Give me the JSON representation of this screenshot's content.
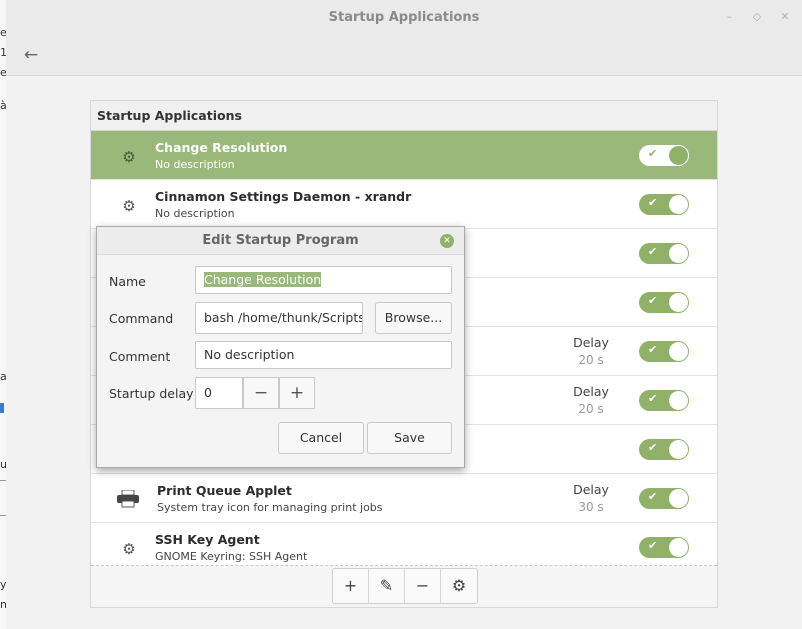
{
  "window": {
    "title": "Startup Applications",
    "back_icon": "back-arrow-icon",
    "controls": {
      "minimize": "–",
      "restore": "◇",
      "close": "✕"
    }
  },
  "panel": {
    "heading": "Startup Applications",
    "delay_label": "Delay"
  },
  "apps": [
    {
      "name": "Change Resolution",
      "description": "No description",
      "enabled": true,
      "delay": "",
      "icon": "gear-icon"
    },
    {
      "name": "Cinnamon Settings Daemon - xrandr",
      "description": "No description",
      "enabled": true,
      "delay": "",
      "icon": "gear-icon"
    },
    {
      "name": "",
      "description": "",
      "enabled": true,
      "delay": "",
      "icon": ""
    },
    {
      "name": "",
      "description": "",
      "enabled": true,
      "delay": "",
      "icon": ""
    },
    {
      "name": "",
      "description": "",
      "enabled": true,
      "delay": "20 s",
      "icon": ""
    },
    {
      "name": "",
      "description": "",
      "enabled": true,
      "delay": "20 s",
      "icon": ""
    },
    {
      "name": "",
      "description": "",
      "enabled": true,
      "delay": "",
      "icon": ""
    },
    {
      "name": "Print Queue Applet",
      "description": "System tray icon for managing print jobs",
      "enabled": true,
      "delay": "30 s",
      "icon": "printer-icon"
    },
    {
      "name": "SSH Key Agent",
      "description": "GNOME Keyring: SSH Agent",
      "enabled": true,
      "delay": "",
      "icon": "gear-icon"
    }
  ],
  "toolbar": {
    "add": "+",
    "edit": "✎",
    "remove": "−",
    "settings": "⚙"
  },
  "dialog": {
    "title": "Edit Startup Program",
    "name_label": "Name",
    "name_value": "Change Resolution",
    "command_label": "Command",
    "command_value": "bash  /home/thunk/Scripts/",
    "browse_label": "Browse...",
    "comment_label": "Comment",
    "comment_value": "No description",
    "delay_label": "Startup delay",
    "delay_value": "0",
    "minus": "−",
    "plus": "+",
    "cancel_label": "Cancel",
    "save_label": "Save"
  },
  "colors": {
    "accent": "#9ab87a",
    "toggle_on": "#8fb268"
  }
}
